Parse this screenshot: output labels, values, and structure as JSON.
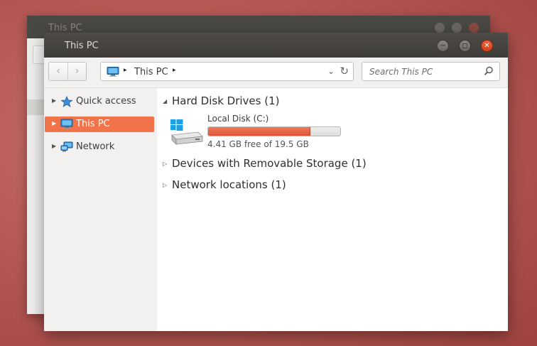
{
  "background_window": {
    "title": "This PC"
  },
  "window": {
    "title": "This PC",
    "buttons": {
      "minimize": "−",
      "maximize": "◻",
      "close": "✕"
    }
  },
  "toolbar": {
    "back": "‹",
    "forward": "›",
    "address": {
      "location": "This PC",
      "separator": "▸",
      "dropdown": "⌄",
      "refresh": "↻"
    },
    "search": {
      "placeholder": "Search This PC"
    }
  },
  "sidebar": {
    "items": [
      {
        "label": "Quick access",
        "icon": "star-pin-icon",
        "selected": false
      },
      {
        "label": "This PC",
        "icon": "computer-icon",
        "selected": true
      },
      {
        "label": "Network",
        "icon": "network-icon",
        "selected": false
      }
    ]
  },
  "content": {
    "groups": [
      {
        "label": "Hard Disk Drives (1)",
        "expanded": true
      },
      {
        "label": "Devices with Removable Storage (1)",
        "expanded": false
      },
      {
        "label": "Network locations (1)",
        "expanded": false
      }
    ],
    "drive": {
      "name": "Local Disk (C:)",
      "free_text": "4.41 GB free of 19.5 GB",
      "used_fraction": 0.774,
      "icon": "hard-drive-windows-icon"
    }
  },
  "colors": {
    "accent": "#f0734a",
    "titlebar": "#3e3c3a",
    "close_button": "#e5502a",
    "sidebar_bg": "#f2f1f0"
  }
}
